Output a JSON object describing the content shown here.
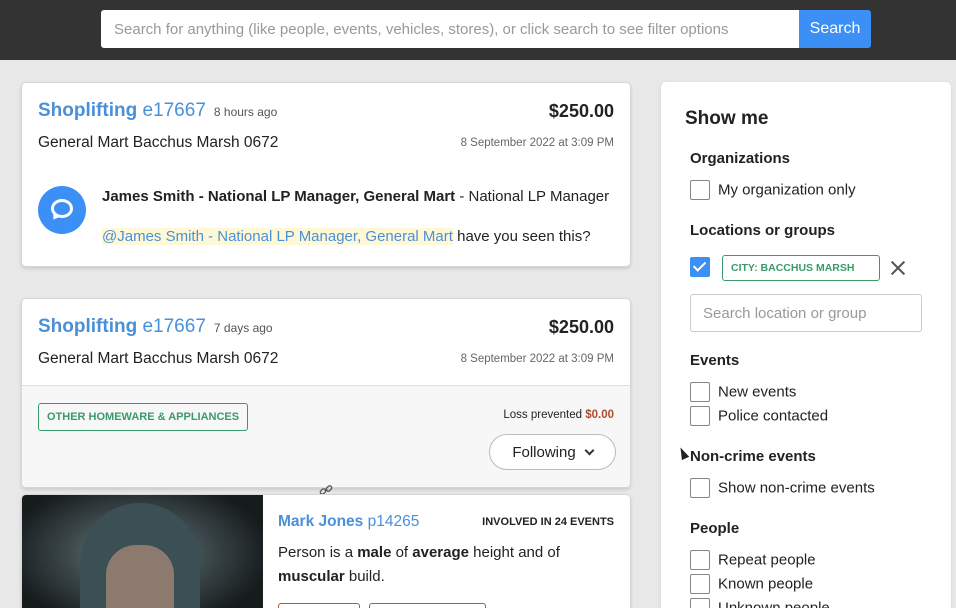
{
  "header": {
    "search_placeholder": "Search for anything (like people, events, vehicles, stores), or click search to see filter options",
    "search_button": "Search",
    "colors": {
      "bar": "#333333",
      "accent": "#3b8ff5"
    }
  },
  "events": [
    {
      "type": "Shoplifting",
      "id": "e17667",
      "time_ago": "8 hours ago",
      "amount": "$250.00",
      "store": "General Mart Bacchus Marsh 0672",
      "date": "8 September 2022 at 3:09 PM",
      "comment": {
        "author": "James Smith - National LP Manager, General Mart",
        "author_role": " - National LP Manager",
        "mention": "@James Smith - National LP Manager, General Mart",
        "text": " have you seen this?"
      }
    },
    {
      "type": "Shoplifting",
      "id": "e17667",
      "time_ago": "7 days ago",
      "amount": "$250.00",
      "store": "General Mart Bacchus Marsh 0672",
      "date": "8 September 2022 at 3:09 PM",
      "category_tag": "OTHER HOMEWARE & APPLIANCES",
      "loss_label": "Loss prevented ",
      "loss_value": "$0.00",
      "follow_button": "Following"
    }
  ],
  "person": {
    "name": "Mark Jones",
    "id": "p14265",
    "involved": "INVOLVED IN 24 EVENTS",
    "desc_1": "Person is a ",
    "gender": "male",
    "desc_2": " of ",
    "height": "average",
    "desc_3": " height and of ",
    "build": "muscular",
    "desc_4": " build."
  },
  "sidebar": {
    "title": "Show me",
    "organizations": {
      "heading": "Organizations",
      "my_org": "My organization only"
    },
    "locations": {
      "heading": "Locations or groups",
      "city_tag": "CITY: BACCHUS MARSH",
      "search_placeholder": "Search location or group"
    },
    "events": {
      "heading": "Events",
      "new_events": "New events",
      "police": "Police contacted"
    },
    "noncrime": {
      "heading": "Non-crime events",
      "show": "Show non-crime events"
    },
    "people": {
      "heading": "People",
      "repeat": "Repeat people",
      "known": "Known people",
      "unknown": "Unknown people"
    }
  }
}
